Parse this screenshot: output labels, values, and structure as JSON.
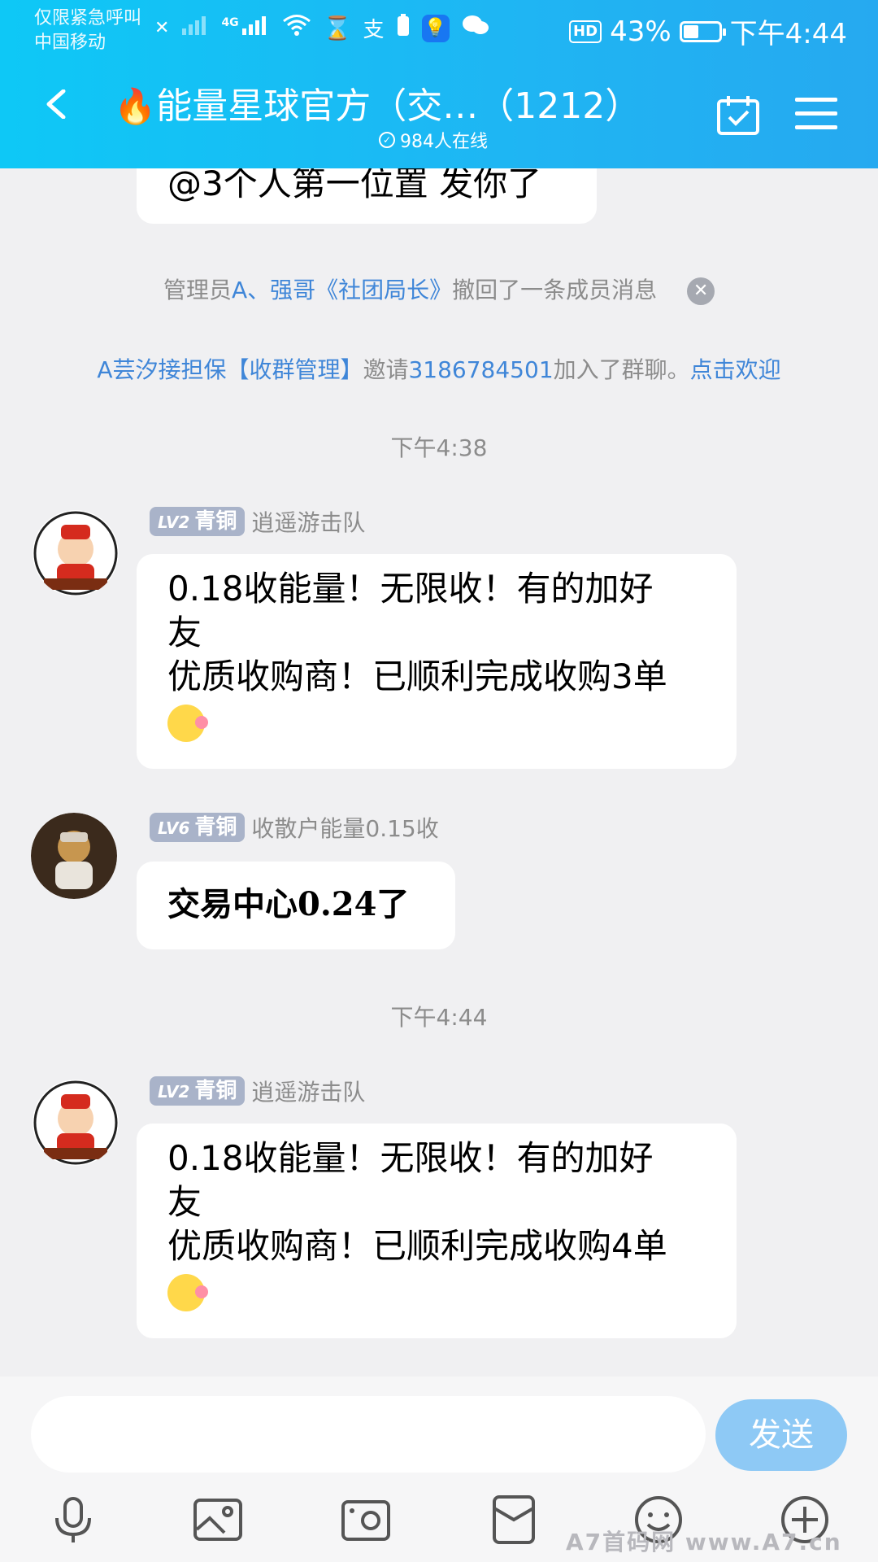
{
  "status_bar": {
    "carrier_line1": "仅限紧急呼叫",
    "carrier_line2": "中国移动",
    "network": "4G",
    "hd_label": "HD",
    "battery": "43%",
    "battery_level": 0.43,
    "time": "下午4:44"
  },
  "header": {
    "flame": "🔥",
    "title": "能量星球官方（交…（1212）",
    "online": "984人在线"
  },
  "messages": {
    "partial_top_text": "@3个人第一位置 发你了",
    "recall_notice": {
      "prefix": "管理员",
      "names": "A、强哥《社团局长》",
      "suffix": "撤回了一条成员消息"
    },
    "join_notice": {
      "inviter": "A芸汐接担保【收群管理】",
      "invite_word": "邀请",
      "invitee": "3186784501",
      "joined_text": "加入了群聊。",
      "welcome": "点击欢迎"
    },
    "time1": "下午4:38",
    "msg1": {
      "level": "LV2",
      "rank": "青铜",
      "name": "逍遥游击队",
      "line1": "0.18收能量！无限收！有的加好",
      "line2": "友",
      "line3": "优质收购商！已顺利完成收购3单"
    },
    "msg2": {
      "level": "LV6",
      "rank": "青铜",
      "name": "收散户能量0.15收",
      "text": "交易中心0.24了"
    },
    "time2": "下午4:44",
    "msg3": {
      "level": "LV2",
      "rank": "青铜",
      "name": "逍遥游击队",
      "line1": "0.18收能量！无限收！有的加好",
      "line2": "友",
      "line3": "优质收购商！已顺利完成收购4单"
    }
  },
  "input": {
    "send_label": "发送"
  },
  "watermark": "A7首码网  www.A7.cn"
}
